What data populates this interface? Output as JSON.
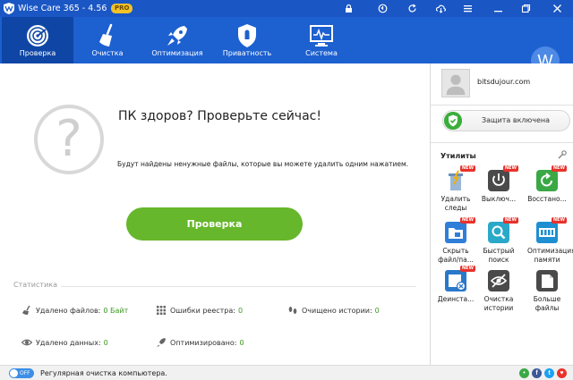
{
  "app": {
    "title": "Wise Care 365 - 4.56",
    "badge": "PRO"
  },
  "titlebar_icons": [
    "lock-icon",
    "update-icon",
    "refresh-icon",
    "cloud-icon",
    "menu-icon",
    "minimize-icon",
    "restore-icon",
    "close-icon"
  ],
  "nav": {
    "items": [
      {
        "label": "Проверка",
        "icon": "target-icon",
        "active": true
      },
      {
        "label": "Очистка",
        "icon": "broom-icon",
        "active": false
      },
      {
        "label": "Оптимизация",
        "icon": "rocket-icon",
        "active": false
      },
      {
        "label": "Приватность",
        "icon": "shield-icon",
        "active": false
      },
      {
        "label": "Система",
        "icon": "monitor-icon",
        "active": false
      }
    ],
    "avatar_letter": "W"
  },
  "main": {
    "headline": "ПК здоров? Проверьте сейчас!",
    "subtext": "Будут найдены ненужные файлы, которые вы можете удалить одним нажатием.",
    "scan_button": "Проверка",
    "question_mark": "?"
  },
  "stats": {
    "title": "Статистика",
    "deleted_files": {
      "label": "Удалено файлов:",
      "value": "0 Байт"
    },
    "registry_errors": {
      "label": "Ошибки реестра:",
      "value": "0"
    },
    "history_cleaned": {
      "label": "Очищено истории:",
      "value": "0"
    },
    "deleted_data": {
      "label": "Удалено данных:",
      "value": "0"
    },
    "optimized": {
      "label": "Оптимизировано:",
      "value": "0"
    }
  },
  "sidebar": {
    "username": "bitsdujour.com",
    "protection_label": "Защита включена",
    "utilities_title": "Утилиты",
    "utilities": [
      {
        "label": "Удалить следы",
        "icon": "trash-icon",
        "new": true,
        "color": "#6aa0d8"
      },
      {
        "label": "Выключ...",
        "icon": "power-icon",
        "new": true,
        "color": "#4a4a4a"
      },
      {
        "label": "Восстано...",
        "icon": "restore-icon",
        "new": true,
        "color": "#3aa845"
      },
      {
        "label": "Скрыть файл/па...",
        "icon": "folder-icon",
        "new": true,
        "color": "#2f7fd8"
      },
      {
        "label": "Быстрый поиск",
        "icon": "search-icon",
        "new": true,
        "color": "#2aa8c8"
      },
      {
        "label": "Оптимизация памяти",
        "icon": "memory-icon",
        "new": true,
        "color": "#1e8fd0"
      },
      {
        "label": "Деинста...",
        "icon": "uninstall-icon",
        "new": true,
        "color": "#2a78c8"
      },
      {
        "label": "Очистка истории",
        "icon": "privacy-icon",
        "new": false,
        "color": "#4a4a4a"
      },
      {
        "label": "Больше файлы",
        "icon": "bigfile-icon",
        "new": false,
        "color": "#4a4a4a"
      }
    ],
    "new_badge": "NEW"
  },
  "statusbar": {
    "toggle_label": "OFF",
    "text": "Регулярная очистка компьютера."
  },
  "colors": {
    "titlebar": "#1a56c4",
    "nav": "#1d60d0",
    "nav_active": "#0f46a6",
    "accent_green": "#66b72b"
  }
}
